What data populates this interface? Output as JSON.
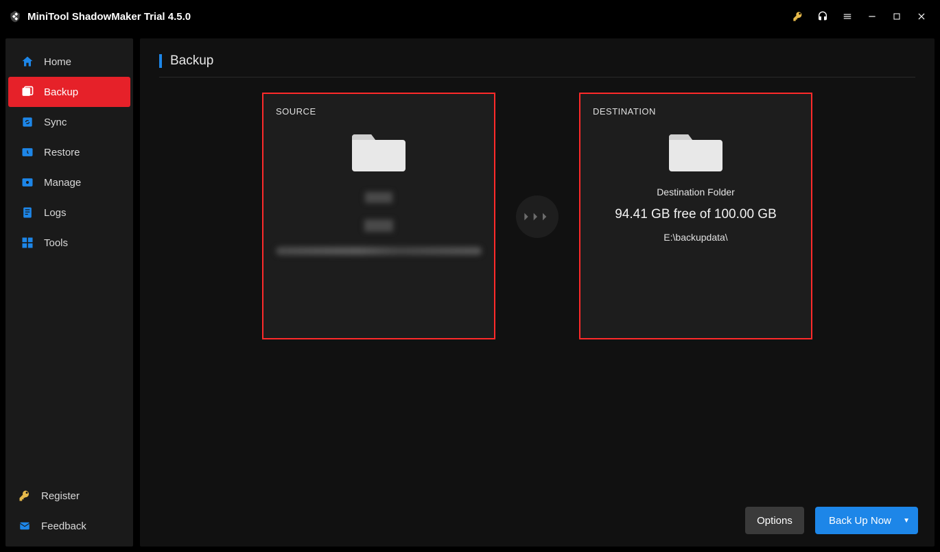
{
  "app": {
    "title": "MiniTool ShadowMaker Trial 4.5.0"
  },
  "sidebar": {
    "items": [
      {
        "label": "Home"
      },
      {
        "label": "Backup"
      },
      {
        "label": "Sync"
      },
      {
        "label": "Restore"
      },
      {
        "label": "Manage"
      },
      {
        "label": "Logs"
      },
      {
        "label": "Tools"
      }
    ],
    "footer": {
      "register": "Register",
      "feedback": "Feedback"
    }
  },
  "page": {
    "title": "Backup"
  },
  "source": {
    "heading": "SOURCE"
  },
  "destination": {
    "heading": "DESTINATION",
    "title": "Destination Folder",
    "free_text": "94.41 GB free of 100.00 GB",
    "path": "E:\\backupdata\\"
  },
  "actions": {
    "options": "Options",
    "backup_now": "Back Up Now"
  }
}
